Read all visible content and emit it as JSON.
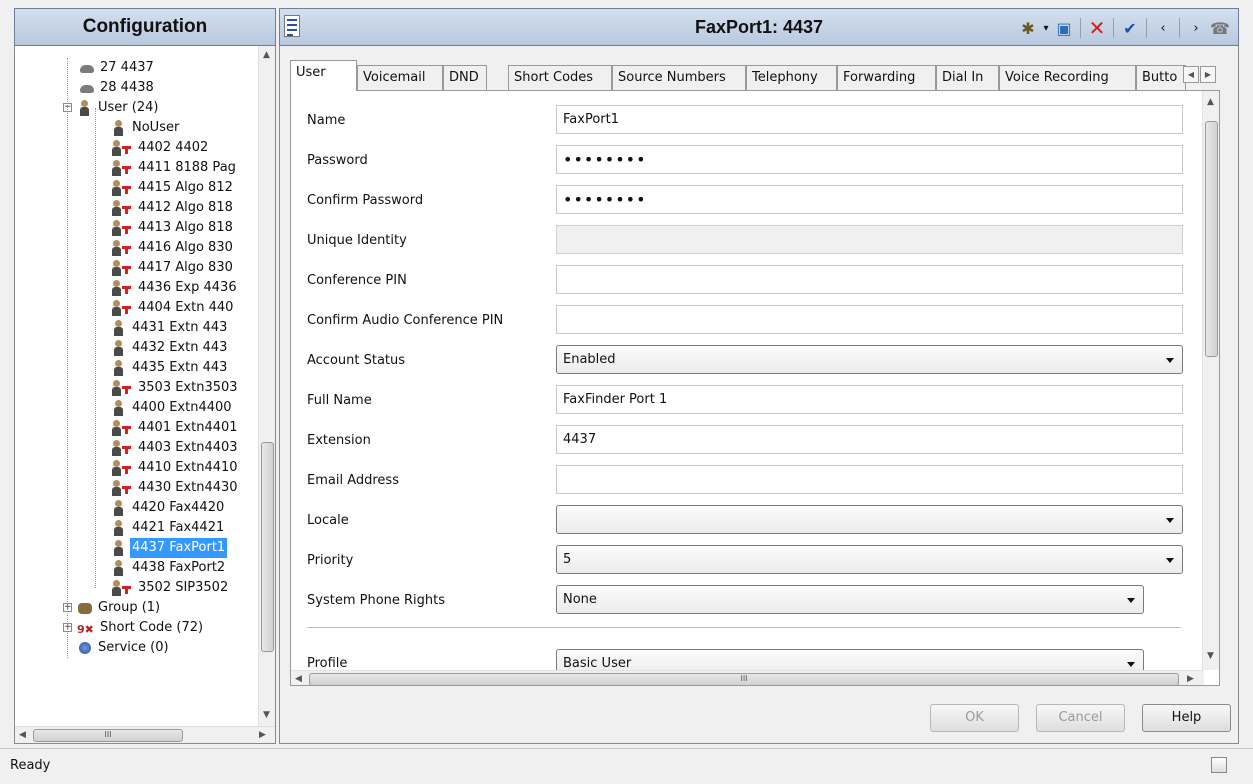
{
  "left_panel": {
    "title": "Configuration",
    "tree": [
      {
        "label": "27 4437",
        "icon": "phone-icon"
      },
      {
        "label": "28 4438",
        "icon": "phone-icon"
      },
      {
        "label": "User (24)",
        "icon": "user-icon"
      },
      {
        "label": "NoUser",
        "icon": "user-icon"
      },
      {
        "label": "4402 4402",
        "icon": "user-red-icon"
      },
      {
        "label": "4411 8188 Pag",
        "icon": "user-red-icon"
      },
      {
        "label": "4415 Algo 812",
        "icon": "user-red-icon"
      },
      {
        "label": "4412 Algo 818",
        "icon": "user-red-icon"
      },
      {
        "label": "4413 Algo 818",
        "icon": "user-red-icon"
      },
      {
        "label": "4416 Algo 830",
        "icon": "user-red-icon"
      },
      {
        "label": "4417 Algo 830",
        "icon": "user-red-icon"
      },
      {
        "label": "4436 Exp 4436",
        "icon": "user-red-icon"
      },
      {
        "label": "4404 Extn 440",
        "icon": "user-red-icon"
      },
      {
        "label": "4431 Extn 443",
        "icon": "user-icon"
      },
      {
        "label": "4432 Extn 443",
        "icon": "user-icon"
      },
      {
        "label": "4435 Extn 443",
        "icon": "user-icon"
      },
      {
        "label": "3503 Extn3503",
        "icon": "user-red-icon"
      },
      {
        "label": "4400 Extn4400",
        "icon": "user-icon"
      },
      {
        "label": "4401 Extn4401",
        "icon": "user-red-icon"
      },
      {
        "label": "4403 Extn4403",
        "icon": "user-red-icon"
      },
      {
        "label": "4410 Extn4410",
        "icon": "user-red-icon"
      },
      {
        "label": "4430 Extn4430",
        "icon": "user-red-icon"
      },
      {
        "label": "4420 Fax4420",
        "icon": "user-icon"
      },
      {
        "label": "4421 Fax4421",
        "icon": "user-icon"
      },
      {
        "label": "4437 FaxPort1",
        "icon": "user-icon"
      },
      {
        "label": "4438 FaxPort2",
        "icon": "user-icon"
      },
      {
        "label": "3502 SIP3502",
        "icon": "user-red-icon"
      },
      {
        "label": "Group (1)",
        "icon": "group-icon"
      },
      {
        "label": "Short Code (72)",
        "icon": "short-code-icon"
      },
      {
        "label": "Service (0)",
        "icon": "service-icon"
      }
    ],
    "selected_label": "4437 FaxPort1"
  },
  "header": {
    "title": "FaxPort1: 4437"
  },
  "tabs": [
    {
      "label": "User"
    },
    {
      "label": "Voicemail"
    },
    {
      "label": "DND"
    },
    {
      "label": "Short Codes"
    },
    {
      "label": "Source Numbers"
    },
    {
      "label": "Telephony"
    },
    {
      "label": "Forwarding"
    },
    {
      "label": "Dial In"
    },
    {
      "label": "Voice Recording"
    },
    {
      "label": "Butto"
    }
  ],
  "form": {
    "name": {
      "label": "Name",
      "value": "FaxPort1"
    },
    "password": {
      "label": "Password",
      "value": "••••••••"
    },
    "confirm_password": {
      "label": "Confirm Password",
      "value": "••••••••"
    },
    "unique_identity": {
      "label": "Unique Identity",
      "value": ""
    },
    "conference_pin": {
      "label": "Conference PIN",
      "value": ""
    },
    "confirm_conference_pin": {
      "label": "Confirm Audio Conference PIN",
      "value": ""
    },
    "account_status": {
      "label": "Account Status",
      "value": "Enabled"
    },
    "full_name": {
      "label": "Full Name",
      "value": "FaxFinder Port 1"
    },
    "extension": {
      "label": "Extension",
      "value": "4437"
    },
    "email": {
      "label": "Email Address",
      "value": ""
    },
    "locale": {
      "label": "Locale",
      "value": ""
    },
    "priority": {
      "label": "Priority",
      "value": "5"
    },
    "system_phone_rights": {
      "label": "System Phone Rights",
      "value": "None"
    },
    "profile": {
      "label": "Profile",
      "value": "Basic User"
    }
  },
  "buttons": {
    "ok": "OK",
    "cancel": "Cancel",
    "help": "Help"
  },
  "status": {
    "text": "Ready"
  },
  "scroll_glyph": "III"
}
